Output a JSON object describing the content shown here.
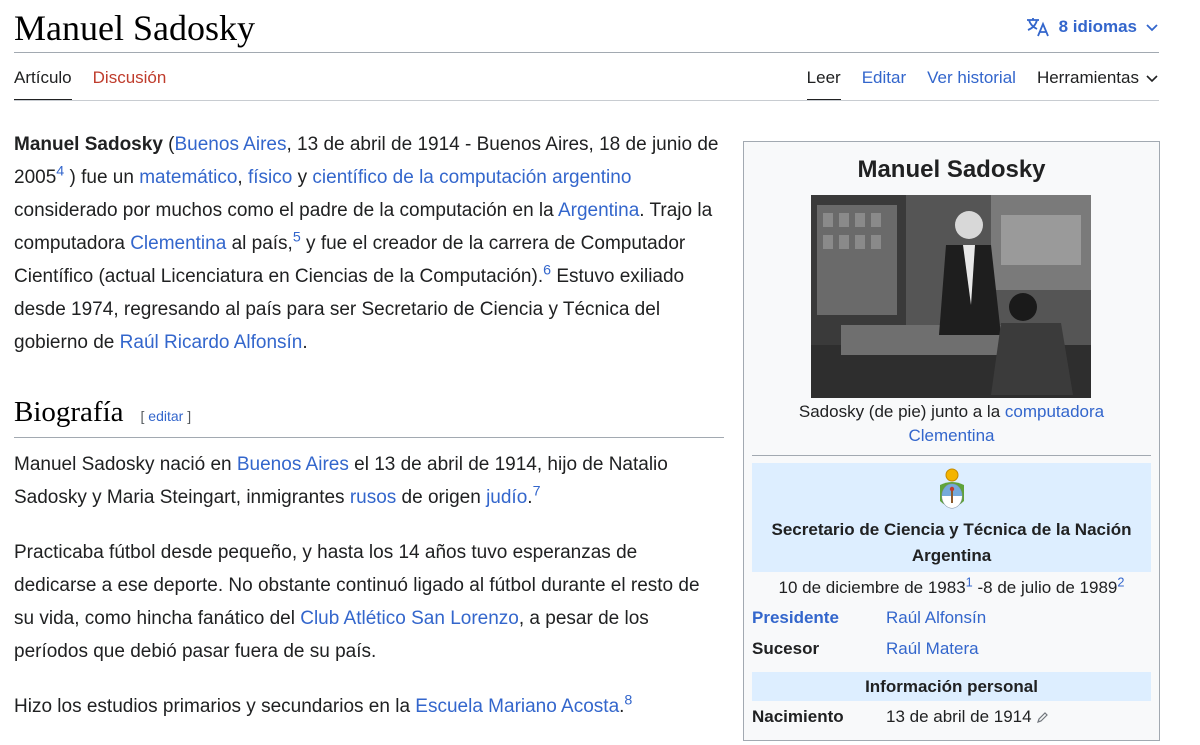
{
  "page": {
    "title": "Manuel Sadosky",
    "languages_label": "8 idiomas"
  },
  "tabs": {
    "article": "Artículo",
    "talk": "Discusión",
    "read": "Leer",
    "edit": "Editar",
    "history": "Ver historial",
    "tools": "Herramientas"
  },
  "intro": {
    "name": "Manuel Sadosky",
    "t1": " (",
    "l_buenos_aires": "Buenos Aires",
    "t2": ", 13 de abril de 1914 - Buenos Aires, 18 de junio de 2005",
    "ref4": "4",
    "t3": " ) fue un ",
    "l_matematico": "matemático",
    "t4": ", ",
    "l_fisico": "físico",
    "t5": " y ",
    "l_cientifico": "científico de la computación argentino",
    "t6": " considerado por muchos como el padre de la computación en la ",
    "l_argentina": "Argentina",
    "t7": ". Trajo la computadora ",
    "l_clementina": "Clementina",
    "t8": " al país,",
    "ref5": "5",
    "t9": "  y fue el creador de la carrera de Computador Científico (actual Licenciatura en Ciencias de la Computación).",
    "ref6": "6",
    "t10": "  Estuvo exiliado desde 1974, regresando al país para ser Secretario de Ciencia y Técnica del gobierno de ",
    "l_alfonsin": "Raúl Ricardo Alfonsín",
    "t11": "."
  },
  "section": {
    "heading": "Biografía",
    "edit_open": "[ ",
    "edit_label": "editar",
    "edit_close": " ]"
  },
  "bio": {
    "p1_t1": "Manuel Sadosky nació en ",
    "p1_l_buenos_aires": "Buenos Aires",
    "p1_t2": " el 13 de abril de 1914, hijo de Natalio Sadosky y Maria Steingart, inmigrantes ",
    "p1_l_rusos": "rusos",
    "p1_t3": " de origen ",
    "p1_l_judio": "judío",
    "p1_t4": ".",
    "p1_ref": "7",
    "p2_t1": "Practicaba fútbol desde pequeño, y hasta los 14 años tuvo esperanzas de dedicarse a ese deporte. No obstante continuó ligado al fútbol durante el resto de su vida, como hincha fanático del ",
    "p2_l_club": "Club Atlético San Lorenzo",
    "p2_t2": ", a pesar de los períodos que debió pasar fuera de su país.",
    "p3_t1": "Hizo los estudios primarios y secundarios en la ",
    "p3_l_escuela": "Escuela Mariano Acosta",
    "p3_t2": ".",
    "p3_ref": "8"
  },
  "infobox": {
    "title": "Manuel Sadosky",
    "caption_text": "Sadosky (de pie) junto a la ",
    "caption_link": "computadora Clementina",
    "office_title": "Secretario de Ciencia y Técnica de la Nación Argentina",
    "dates_start": "10 de diciembre de 1983",
    "dates_ref1": "1",
    "dates_sep": " -8 de julio de 1989",
    "dates_ref2": "2",
    "president_label": "Presidente",
    "president_value": "Raúl Alfonsín",
    "successor_label": "Sucesor",
    "successor_value": "Raúl Matera",
    "personal_heading": "Información personal",
    "birth_label": "Nacimiento",
    "birth_value": "13 de abril de 1914"
  },
  "colors": {
    "link": "#3366cc",
    "link_new": "#bf3c2c",
    "infobox_bg": "#f8f9fa",
    "infobox_header_bg": "#ddeeff"
  },
  "icons": [
    "translate-icon",
    "chevron-down-icon",
    "coat-of-arms-emblem",
    "pencil-icon"
  ]
}
